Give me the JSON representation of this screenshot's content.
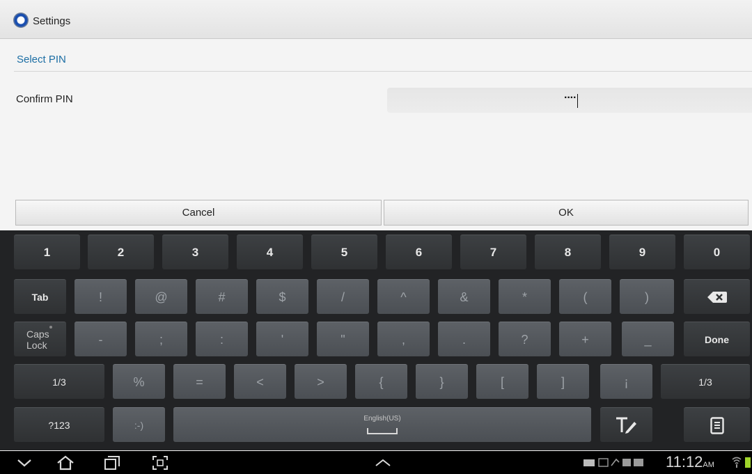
{
  "app": {
    "title": "Settings",
    "icon": "settings-gear-icon"
  },
  "dialog": {
    "title": "Select PIN",
    "field_label": "Confirm PIN",
    "pin_value": "····",
    "cancel_label": "Cancel",
    "ok_label": "OK"
  },
  "keyboard": {
    "row1": [
      "1",
      "2",
      "3",
      "4",
      "5",
      "6",
      "7",
      "8",
      "9",
      "0"
    ],
    "row2": [
      "Tab",
      "!",
      "@",
      "#",
      "$",
      "/",
      "^",
      "&",
      "*",
      "(",
      ")"
    ],
    "row3": [
      "Caps Lock",
      "-",
      ";",
      ":",
      "'",
      "\"",
      ",",
      ".",
      "?",
      "+",
      "_",
      "Done"
    ],
    "row4": [
      "1/3",
      "%",
      "=",
      "<",
      ">",
      "{",
      "}",
      "[",
      "]",
      "¡",
      "1/3"
    ],
    "row5": {
      "sym": "?123",
      "emoticon": ":-)",
      "space_label": "English(US)"
    }
  },
  "status_bar": {
    "time": "11:12",
    "ampm": "AM",
    "battery_color": "#9fd42b"
  }
}
